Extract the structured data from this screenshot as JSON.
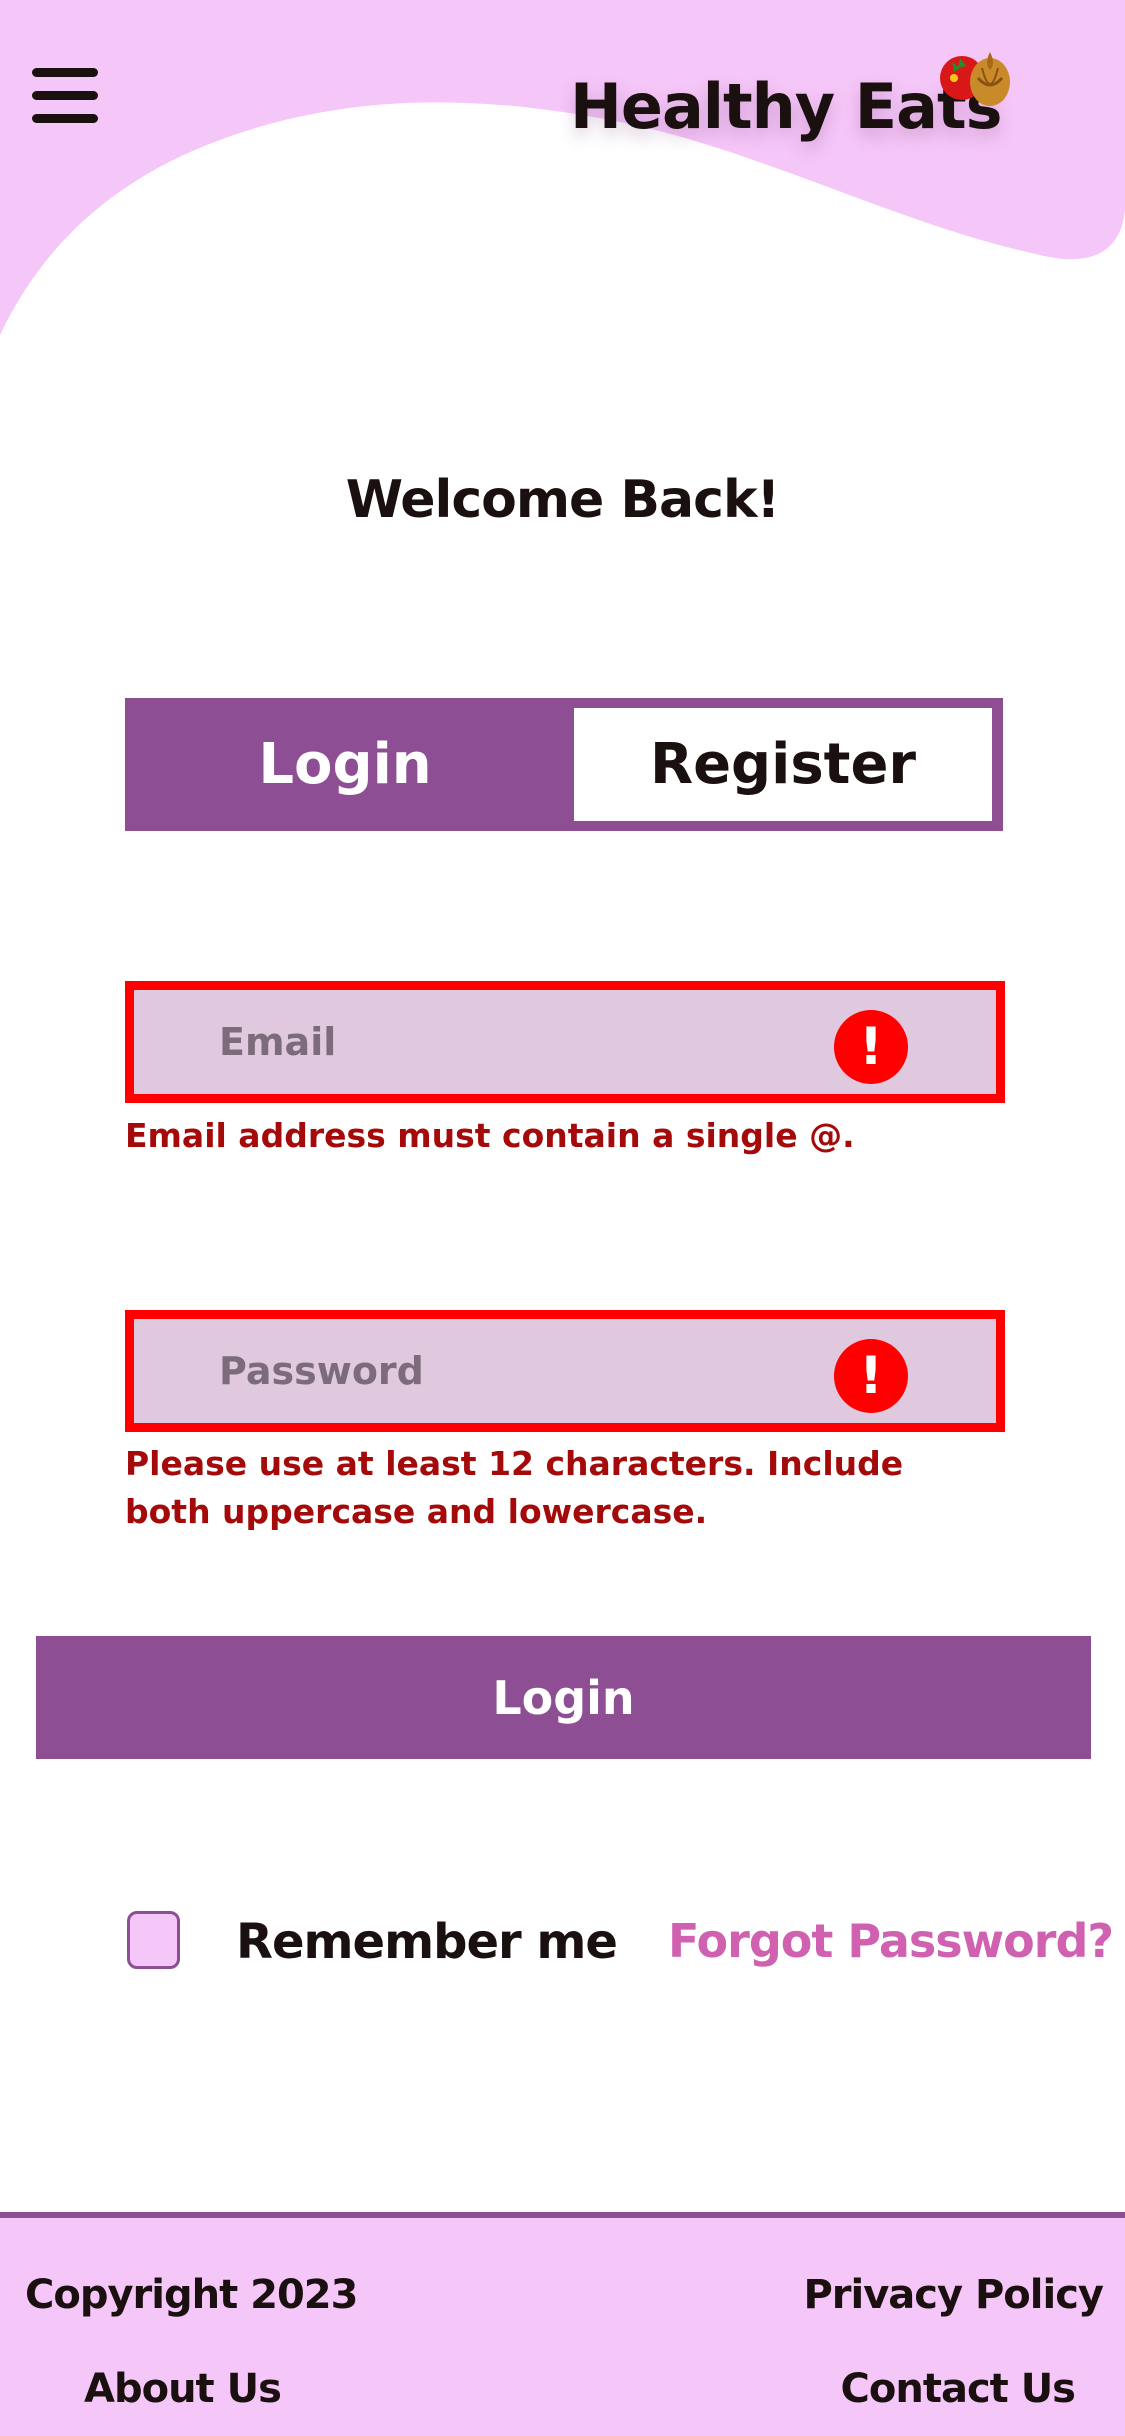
{
  "header": {
    "logo_text": "Healthy Eats",
    "menu_icon": "hamburger-menu-icon",
    "logo_icon": "vegetables-icon"
  },
  "welcome": "Welcome Back!",
  "tabs": [
    {
      "label": "Login",
      "active": true
    },
    {
      "label": "Register",
      "active": false
    }
  ],
  "form": {
    "email": {
      "placeholder": "Email",
      "value": "",
      "error": "Email address must contain a single @."
    },
    "password": {
      "placeholder": "Password",
      "value": "",
      "error": "Please use at least 12 characters. Include both uppercase and lowercase."
    },
    "error_icon": "exclamation-icon",
    "submit_label": "Login",
    "remember_label": "Remember me",
    "remember_checked": false,
    "forgot_label": "Forgot Password?"
  },
  "footer": {
    "copyright": "Copyright 2023",
    "privacy": "Privacy Policy",
    "about": "About Us",
    "contact": "Contact Us"
  },
  "colors": {
    "primary": "#8e4e93",
    "header_bg": "#f5c6f8",
    "field_bg": "#e0c8df",
    "error": "#ff0000",
    "error_text": "#a50a0a",
    "link": "#d060b0"
  }
}
